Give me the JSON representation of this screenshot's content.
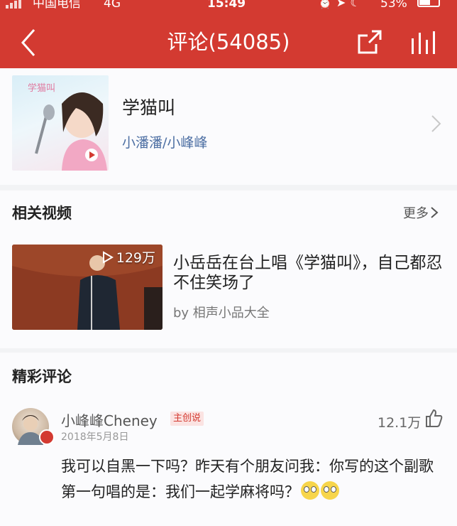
{
  "status_bar": {
    "carrier": "中国电信",
    "network": "4G",
    "time": "15:49",
    "icons": [
      "alarm-icon",
      "location-icon",
      "moon-icon"
    ],
    "battery_text": "53%",
    "battery_level": 0.53
  },
  "header": {
    "title": "评论(54085)",
    "back_icon": "chevron-left-icon",
    "share_icon": "share-icon",
    "chart_icon": "bar-chart-icon"
  },
  "song": {
    "title": "学猫叫",
    "artist": "小潘潘/小峰峰",
    "cover_text": "学猫叫"
  },
  "related_videos": {
    "title": "相关视频",
    "more_label": "更多",
    "items": [
      {
        "title": "小岳岳在台上唱《学猫叫》，自己都忍不住笑场了",
        "play_count": "129万",
        "source": "by 相声小品大全"
      }
    ]
  },
  "comments": {
    "title": "精彩评论",
    "items": [
      {
        "username": "小峰峰Cheney",
        "tag": "主创说",
        "date": "2018年5月8日",
        "likes": "12.1万",
        "text": "我可以自黑一下吗？昨天有个朋友问我：你写的这个副歌第一句唱的是：我们一起学麻将吗？",
        "emoji_count": 2
      }
    ]
  },
  "colors": {
    "brand_red": "#d33a31",
    "link_blue": "#4d6fa3",
    "background": "#f2f3f5"
  }
}
